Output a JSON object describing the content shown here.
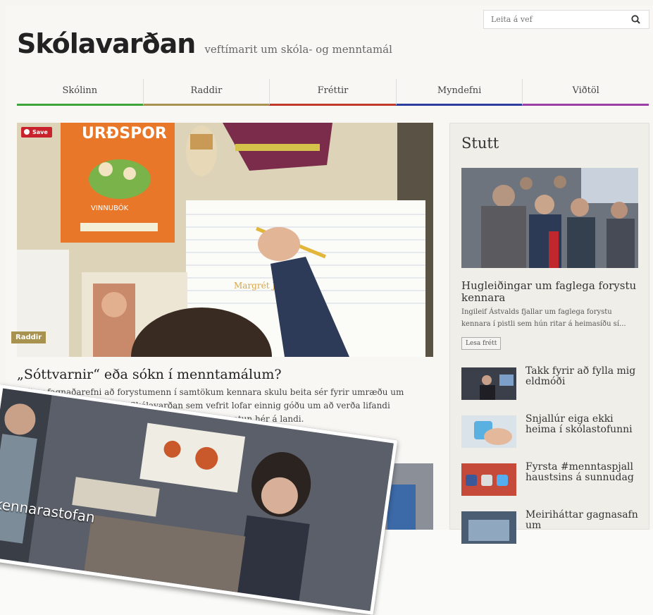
{
  "site": {
    "logo": "Skólavarðan",
    "tagline": "veftímarit um skóla- og menntamál"
  },
  "search": {
    "placeholder": "Leita á vef",
    "icon": "search-icon"
  },
  "nav": {
    "items": [
      {
        "label": "Skólinn",
        "color": "#3da53a"
      },
      {
        "label": "Raddir",
        "color": "#a89250"
      },
      {
        "label": "Fréttir",
        "color": "#c0392b"
      },
      {
        "label": "Myndefni",
        "color": "#2e3d9e"
      },
      {
        "label": "Viðtöl",
        "color": "#9b3ea5"
      }
    ]
  },
  "featured": {
    "save_label": "Save",
    "category": "Raddir",
    "title": "„Sóttvarnir“ eða sókn í menntamálum?",
    "excerpt_line1": "Það er fagnaðarefni að forystumenn í samtökum kennara skulu beita sér fyrir umræðu um",
    "excerpt_line2": "... á opinberum vettvangi. Skólavarðan sem vefrit lofar einnig góðu um að verða lifandi",
    "excerpt_line3": "... um það sem mestu skiptir í skólamálum og menntun hér á landi.",
    "image_texts": {
      "book_title": "URÐSPOR",
      "book_sub": "VINNUBÓK",
      "notebook": "Margrét Jóna"
    }
  },
  "sidebar": {
    "title": "Stutt",
    "feature": {
      "title": "Hugleiðingar um faglega forystu kennara",
      "excerpt": "Ingileif Ástvalds fjallar um faglega forystu kennara í pistli sem hún ritar á heimasíðu sí...",
      "button": "Lesa frétt"
    },
    "items": [
      {
        "title": "Takk fyrir að fylla mig eldmóði"
      },
      {
        "title": "Snjallúr eiga ekki heima í skólastofunni"
      },
      {
        "title": "Fyrsta #menntaspjall haustsins á sunnudag"
      },
      {
        "title": "Meiriháttar gagnasafn um"
      }
    ]
  },
  "overlay": {
    "caption": "kennarastofan"
  }
}
